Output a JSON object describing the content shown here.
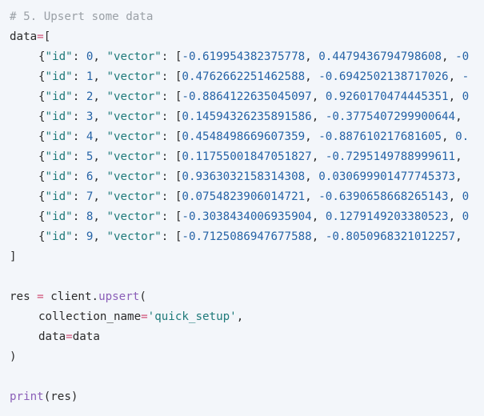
{
  "code": {
    "comment": "# 5. Upsert some data",
    "data_var": "data",
    "assign": "=",
    "open_bracket": "[",
    "close_bracket": "]",
    "id_key": "\"id\"",
    "vector_key": "\"vector\"",
    "rows": [
      {
        "id": "0",
        "v1": "-0.619954382375778",
        "v2": "0.4479436794798608",
        "tail": "-0"
      },
      {
        "id": "1",
        "v1": "0.4762662251462588",
        "v2": "-0.6942502138717026",
        "tail": "-"
      },
      {
        "id": "2",
        "v1": "-0.8864122635045097",
        "v2": "0.9260170474445351",
        "tail": "0"
      },
      {
        "id": "3",
        "v1": "0.14594326235891586",
        "v2": "-0.3775407299900644",
        "tail": ""
      },
      {
        "id": "4",
        "v1": "0.4548498669607359",
        "v2": "-0.887610217681605",
        "tail": "0."
      },
      {
        "id": "5",
        "v1": "0.11755001847051827",
        "v2": "-0.7295149788999611",
        "tail": ""
      },
      {
        "id": "6",
        "v1": "0.9363032158314308",
        "v2": "0.030699901477745373",
        "tail": ""
      },
      {
        "id": "7",
        "v1": "0.0754823906014721",
        "v2": "-0.6390658668265143",
        "tail": "0"
      },
      {
        "id": "8",
        "v1": "-0.3038434006935904",
        "v2": "0.1279149203380523",
        "tail": "0"
      },
      {
        "id": "9",
        "v1": "-0.7125086947677588",
        "v2": "-0.8050968321012257",
        "tail": ""
      }
    ],
    "res_var": "res",
    "client_obj": "client",
    "upsert_fn": "upsert",
    "collection_param": "collection_name",
    "collection_value": "'quick_setup'",
    "data_param": "data",
    "data_value": "data",
    "print_fn": "print",
    "print_arg": "res"
  }
}
